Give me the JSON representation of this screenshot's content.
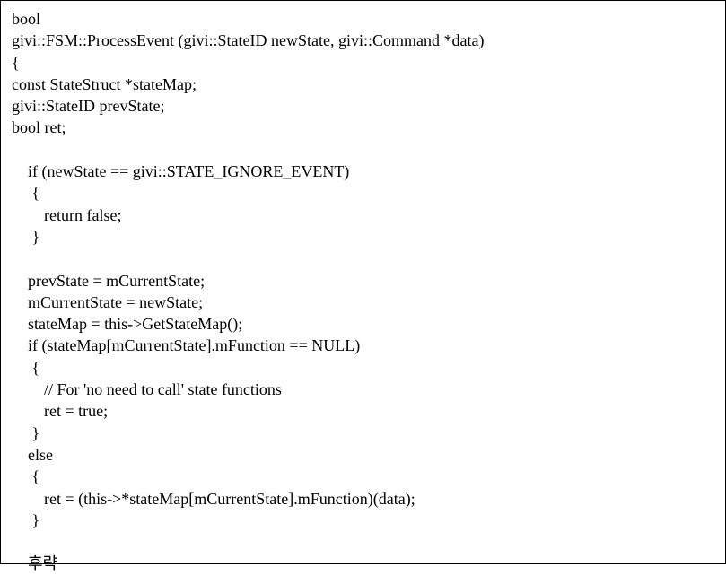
{
  "code": {
    "lines": [
      "bool",
      "givi::FSM::ProcessEvent (givi::StateID newState, givi::Command *data)",
      "{",
      "const StateStruct *stateMap;",
      "givi::StateID prevState;",
      "bool ret;",
      "",
      "    if (newState == givi::STATE_IGNORE_EVENT)",
      "     {",
      "        return false;",
      "     }",
      "",
      "    prevState = mCurrentState;",
      "    mCurrentState = newState;",
      "    stateMap = this->GetStateMap();",
      "    if (stateMap[mCurrentState].mFunction == NULL)",
      "     {",
      "        // For 'no need to call' state functions",
      "        ret = true;",
      "     }",
      "    else",
      "     {",
      "        ret = (this->*stateMap[mCurrentState].mFunction)(data);",
      "     }",
      "",
      "    후략"
    ]
  }
}
